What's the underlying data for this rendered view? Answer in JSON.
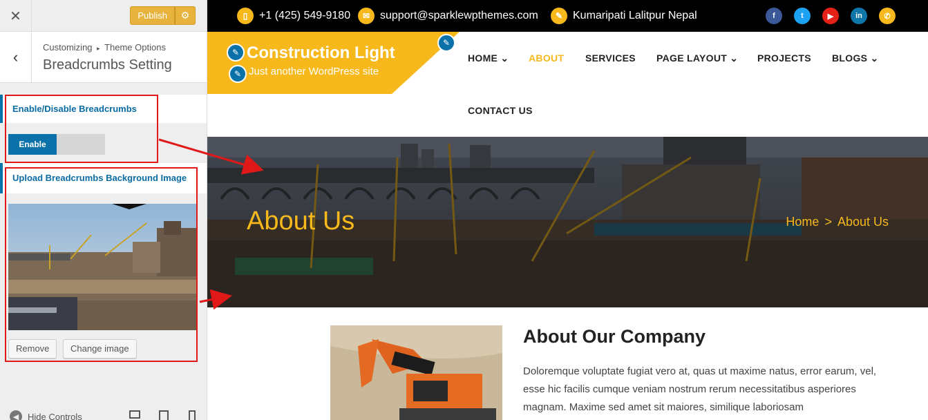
{
  "customizer": {
    "close_icon": "close-icon",
    "publish_label": "Publish",
    "gear_icon": "gear-icon",
    "back_icon": "chevron-left-icon",
    "path_root": "Customizing",
    "path_arrow": "▸",
    "path_section": "Theme Options",
    "section_title": "Breadcrumbs Setting",
    "controls": {
      "enable_label": "Enable/Disable Breadcrumbs",
      "toggle_on_label": "Enable",
      "upload_label": "Upload Breadcrumbs Background Image",
      "remove_label": "Remove",
      "change_label": "Change image"
    },
    "footer": {
      "hide_controls_label": "Hide Controls"
    }
  },
  "site": {
    "topbar": {
      "phone": "+1 (425) 549-9180",
      "email": "support@sparklewpthemes.com",
      "address": "Kumaripati Lalitpur Nepal",
      "social": [
        "facebook-icon",
        "twitter-icon",
        "youtube-icon",
        "linkedin-icon",
        "phone-icon"
      ]
    },
    "title": "Construction Light",
    "tagline": "Just another WordPress site",
    "nav": {
      "home": "HOME",
      "about": "ABOUT",
      "services": "SERVICES",
      "page_layout": "PAGE LAYOUT",
      "projects": "PROJECTS",
      "blogs": "BLOGS",
      "contact": "CONTACT US",
      "caret": "⌄"
    },
    "banner": {
      "title": "About Us",
      "crumb_home": "Home",
      "crumb_sep": ">",
      "crumb_current": "About Us"
    },
    "about": {
      "heading": "About Our Company",
      "body": "Doloremque voluptate fugiat vero at, quas ut maxime natus, error earum, vel, esse hic facilis cumque veniam nostrum rerum necessitatibus asperiores magnam. Maxime sed amet sit maiores, similique laboriosam"
    }
  },
  "colors": {
    "accent": "#f7b81b",
    "wp_blue": "#0073aa",
    "annotation_red": "#e01818"
  }
}
